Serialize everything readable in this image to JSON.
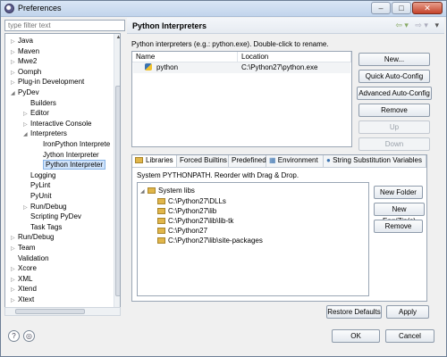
{
  "window": {
    "title": "Preferences"
  },
  "filter": {
    "placeholder": "type filter text"
  },
  "tree": {
    "items": [
      {
        "label": "Java",
        "expander": "▷"
      },
      {
        "label": "Maven",
        "expander": "▷"
      },
      {
        "label": "Mwe2",
        "expander": "▷"
      },
      {
        "label": "Oomph",
        "expander": "▷"
      },
      {
        "label": "Plug-in Development",
        "expander": "▷"
      },
      {
        "label": "PyDev",
        "expander": "◢"
      },
      {
        "label": "Builders",
        "expander": ""
      },
      {
        "label": "Editor",
        "expander": "▷"
      },
      {
        "label": "Interactive Console",
        "expander": "▷"
      },
      {
        "label": "Interpreters",
        "expander": "◢"
      },
      {
        "label": "IronPython Interprete",
        "expander": ""
      },
      {
        "label": "Jython Interpreter",
        "expander": ""
      },
      {
        "label": "Python Interpreter",
        "expander": ""
      },
      {
        "label": "Logging",
        "expander": ""
      },
      {
        "label": "PyLint",
        "expander": ""
      },
      {
        "label": "PyUnit",
        "expander": ""
      },
      {
        "label": "Run/Debug",
        "expander": "▷"
      },
      {
        "label": "Scripting PyDev",
        "expander": ""
      },
      {
        "label": "Task Tags",
        "expander": ""
      },
      {
        "label": "Run/Debug",
        "expander": "▷"
      },
      {
        "label": "Team",
        "expander": "▷"
      },
      {
        "label": "Validation",
        "expander": ""
      },
      {
        "label": "Xcore",
        "expander": "▷"
      },
      {
        "label": "XML",
        "expander": "▷"
      },
      {
        "label": "Xtend",
        "expander": "▷"
      },
      {
        "label": "Xtext",
        "expander": "▷"
      }
    ],
    "selected": "Python Interpreter"
  },
  "page": {
    "title": "Python Interpreters",
    "description": "Python interpreters (e.g.: python.exe).   Double-click to rename."
  },
  "interpreters": {
    "columns": [
      "Name",
      "Location"
    ],
    "rows": [
      {
        "name": "python",
        "location": "C:\\Python27\\python.exe"
      }
    ]
  },
  "buttons": {
    "new": "New...",
    "quick": "Quick Auto-Config",
    "advanced": "Advanced Auto-Config",
    "remove": "Remove",
    "up": "Up",
    "down": "Down"
  },
  "tabs": [
    "Libraries",
    "Forced Builtins",
    "Predefined",
    "Environment",
    "String Substitution Variables"
  ],
  "libraries": {
    "label": "System PYTHONPATH.   Reorder with Drag & Drop.",
    "root": "System libs",
    "paths": [
      "C:\\Python27\\DLLs",
      "C:\\Python27\\lib",
      "C:\\Python27\\lib\\lib-tk",
      "C:\\Python27",
      "C:\\Python27\\lib\\site-packages"
    ],
    "new_folder": "New Folder",
    "new_egg": "New Egg/Zip(s)",
    "remove": "Remove"
  },
  "footer": {
    "restore_defaults": "Restore Defaults",
    "apply": "Apply",
    "ok": "OK",
    "cancel": "Cancel",
    "help": "?"
  }
}
